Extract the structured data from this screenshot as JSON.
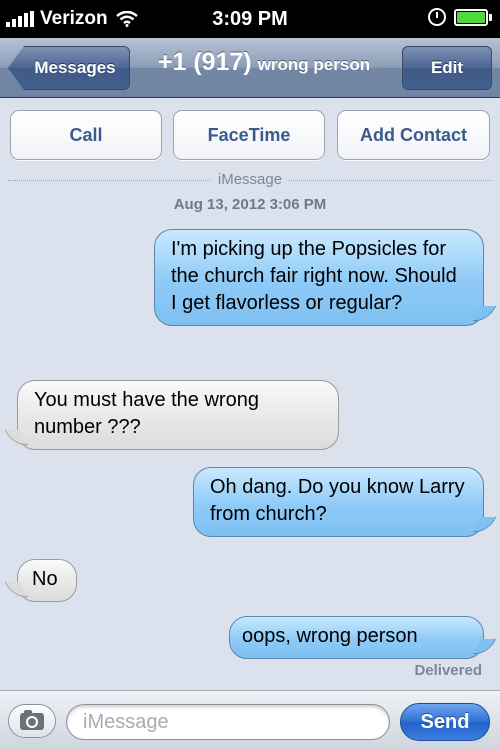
{
  "status_bar": {
    "carrier": "Verizon",
    "time": "3:09 PM"
  },
  "nav": {
    "back_label": "Messages",
    "title_number": "+1 (917)",
    "title_name": "wrong person",
    "edit_label": "Edit"
  },
  "actions": {
    "call": "Call",
    "facetime": "FaceTime",
    "add_contact": "Add Contact"
  },
  "conversation": {
    "service": "iMessage",
    "timestamp": "Aug 13, 2012 3:06 PM",
    "messages": [
      {
        "from": "me",
        "text": "I'm picking up the Popsicles for the church fair right now. Should I get flavorless or regular?"
      },
      {
        "from": "them",
        "text": "You must have the wrong number ???"
      },
      {
        "from": "me",
        "text": "Oh dang. Do you know Larry from church?"
      },
      {
        "from": "them",
        "text": "No"
      },
      {
        "from": "me",
        "text": "oops, wrong person"
      }
    ],
    "status": "Delivered"
  },
  "input_bar": {
    "placeholder": "iMessage",
    "value": "",
    "send_label": "Send"
  },
  "colors": {
    "sent_bubble": "#8ecaf7",
    "received_bubble": "#e6e6e6",
    "background": "#dbe2ed",
    "send_button": "#2f6fd4"
  }
}
